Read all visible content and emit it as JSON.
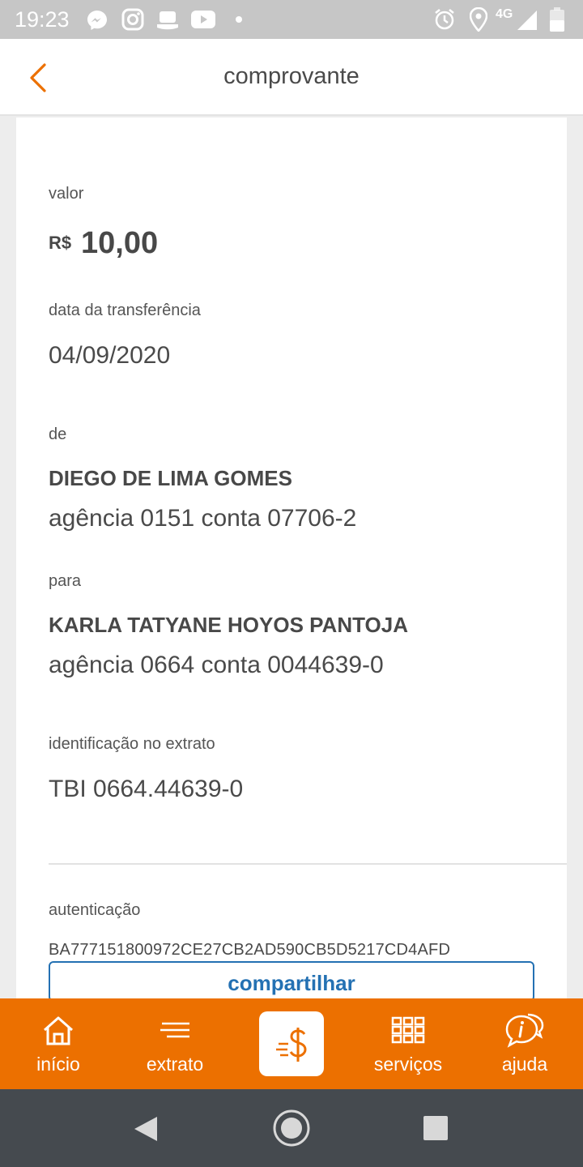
{
  "status_bar": {
    "time": "19:23",
    "network": "4G",
    "left_icons": [
      "messenger-icon",
      "instagram-icon",
      "hat-icon",
      "youtube-icon",
      "dot-icon"
    ],
    "right_icons": [
      "alarm-icon",
      "location-icon",
      "signal-icon",
      "battery-icon"
    ]
  },
  "header": {
    "title": "comprovante",
    "back_icon": "chevron-left-icon"
  },
  "receipt": {
    "value_label": "valor",
    "currency": "R$",
    "amount": "10,00",
    "date_label": "data da transferência",
    "date": "04/09/2020",
    "from_label": "de",
    "from_name": "DIEGO DE LIMA GOMES",
    "from_account": "agência 0151 conta 07706-2",
    "to_label": "para",
    "to_name": "KARLA TATYANE HOYOS PANTOJA",
    "to_account": "agência 0664 conta 0044639-0",
    "statement_label": "identificação no extrato",
    "statement_id": "TBI 0664.44639-0",
    "auth_label": "autenticação",
    "auth_code": "BA777151800972CE27CB2AD590CB5D5217CD4AFD",
    "share_label": "compartilhar"
  },
  "bottom_nav": {
    "items": [
      {
        "label": "início",
        "icon": "home-icon"
      },
      {
        "label": "extrato",
        "icon": "statement-icon"
      },
      {
        "label": "",
        "icon": "transfer-money-icon"
      },
      {
        "label": "serviços",
        "icon": "grid-icon"
      },
      {
        "label": "ajuda",
        "icon": "help-chat-icon"
      }
    ]
  },
  "colors": {
    "accent": "#ec7000",
    "link": "#2471b3",
    "status_bar": "#c6c6c6",
    "system_nav": "#454a4f"
  }
}
